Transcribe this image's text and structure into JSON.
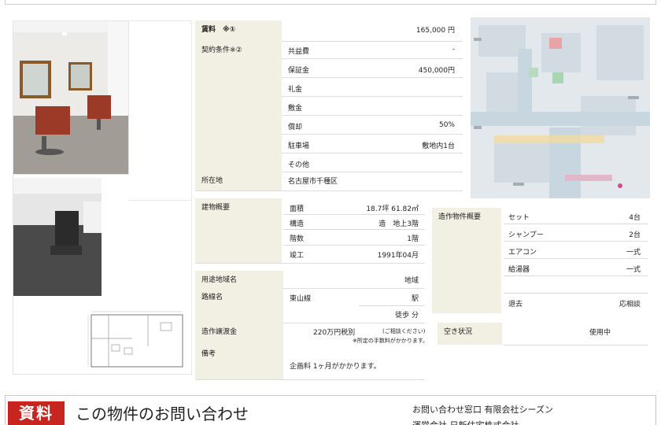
{
  "rent": {
    "label": "賃料　※①",
    "value": "165,000 円"
  },
  "contract": {
    "label": "契約条件※②",
    "rows": [
      {
        "name": "共益費",
        "value": "-"
      },
      {
        "name": "保証金",
        "value": "450,000円"
      },
      {
        "name": "礼金",
        "value": ""
      },
      {
        "name": "敷金",
        "value": ""
      },
      {
        "name": "償却",
        "value": "50%"
      },
      {
        "name": "駐車場",
        "value": "敷地内1台"
      },
      {
        "name": "その他",
        "value": ""
      }
    ]
  },
  "location": {
    "label": "所在地",
    "value": "名古屋市千種区"
  },
  "building": {
    "label": "建物概要",
    "rows": [
      {
        "name": "面積",
        "value": "18.7坪 61.82㎡"
      },
      {
        "name": "構造",
        "value": "造　地上3階"
      },
      {
        "name": "階数",
        "value": "1階"
      },
      {
        "name": "竣工",
        "value": "1991年04月"
      }
    ]
  },
  "transfer_items": {
    "label": "造作物件概要",
    "rows": [
      {
        "name": "セット",
        "value": "4台"
      },
      {
        "name": "シャンプー",
        "value": "2台"
      },
      {
        "name": "エアコン",
        "value": "一式"
      },
      {
        "name": "給湯器",
        "value": "一式"
      },
      {
        "name": "",
        "value": ""
      },
      {
        "name": "退去",
        "value": "応相談"
      }
    ]
  },
  "zoning": {
    "label": "用途地域名",
    "value": "地域"
  },
  "route": {
    "label": "路線名",
    "line": "東山線",
    "station": "駅",
    "walk": "徒歩 分"
  },
  "transfer_fee": {
    "label": "造作譲渡金",
    "value": "220万円税別",
    "note1": "(ご相談ください)",
    "note2": "※所定の手数料がかかります。"
  },
  "vacancy": {
    "label": "空き状況",
    "value": "使用中"
  },
  "remarks": {
    "label": "備考",
    "value": "企画料 1ヶ月がかかります。"
  },
  "footer": {
    "badge": "資料",
    "title": "この物件のお問い合わせ",
    "contact1": "お問い合わせ窓口 有限会社シーズン",
    "contact2": "運営会社 日新住宅株式会社"
  },
  "colors": {
    "label_bg": "#f2efe3",
    "badge_red": "#c92520"
  }
}
